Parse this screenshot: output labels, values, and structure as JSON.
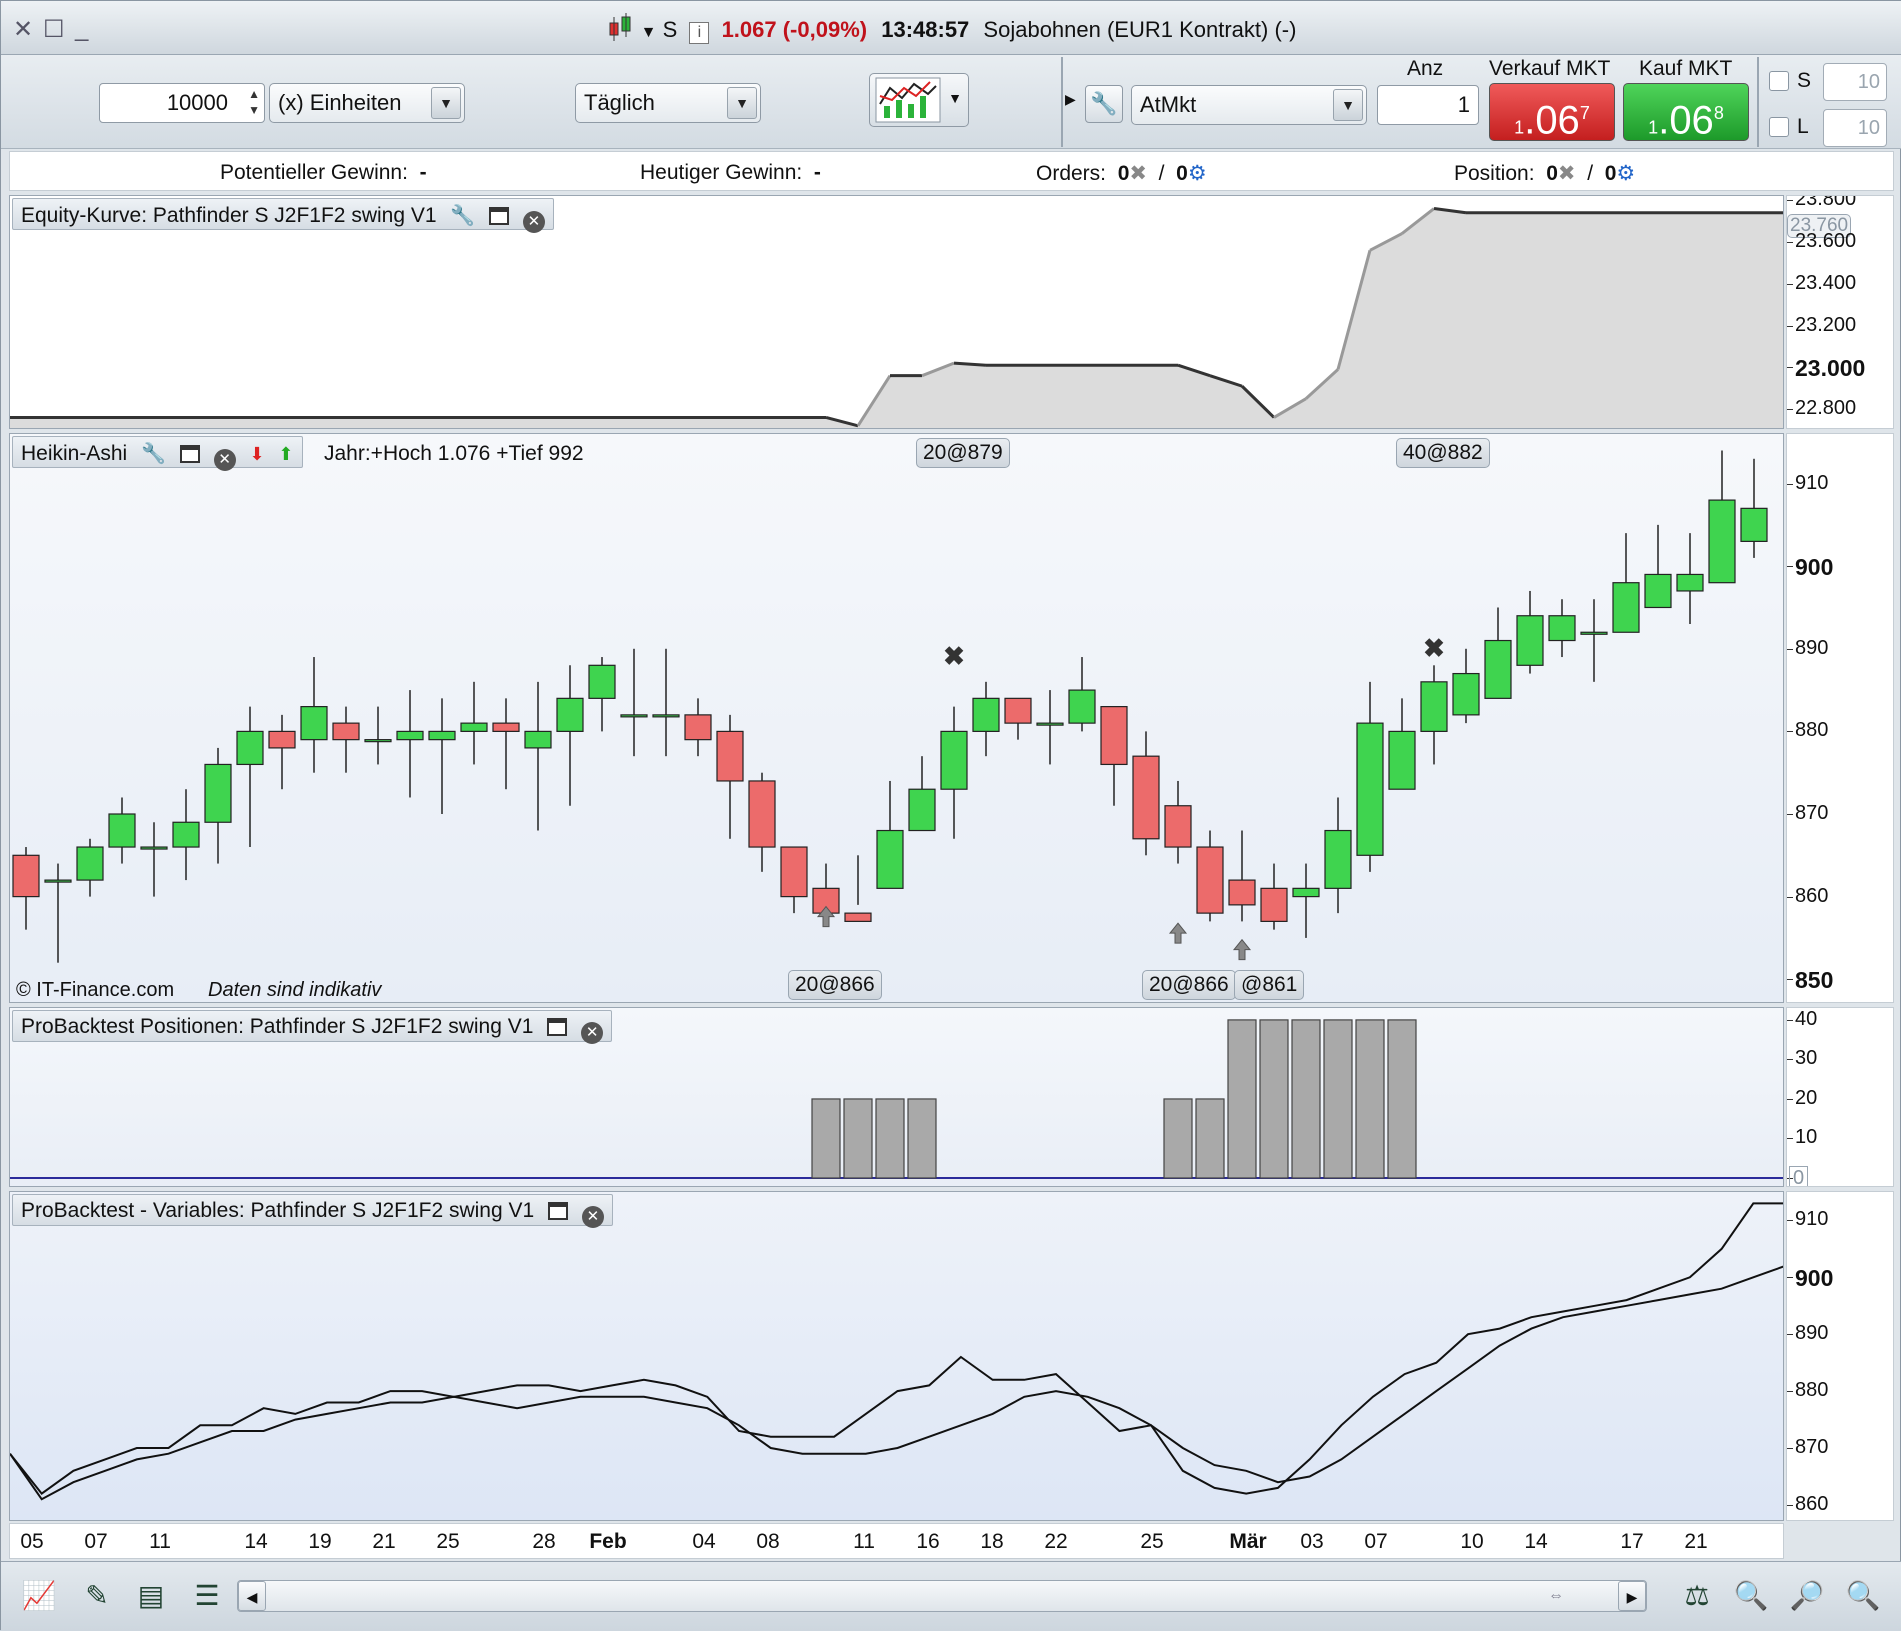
{
  "titlebar": {
    "mode": "S",
    "price_change": "1.067 (-0,09%)",
    "time": "13:48:57",
    "instrument": "Sojabohnen (EUR1 Kontrakt) (-)"
  },
  "toolbar": {
    "quantity": "10000",
    "units": "(x) Einheiten",
    "period": "Täglich",
    "order_type": "AtMkt",
    "anz_label": "Anz",
    "anz_value": "1",
    "sell_label": "Verkauf MKT",
    "buy_label": "Kauf MKT",
    "sell_small": "1",
    "sell_big": "06",
    "sell_sup": "7",
    "buy_small": "1",
    "buy_big": "06",
    "buy_sup": "8",
    "s_label": "S",
    "l_label": "L",
    "s_value": "10",
    "l_value": "10"
  },
  "infobar": {
    "potential_label": "Potentieller Gewinn:",
    "potential_value": "-",
    "today_label": "Heutiger Gewinn:",
    "today_value": "-",
    "orders_label": "Orders:",
    "orders_a": "0",
    "orders_sep": "/",
    "orders_b": "0",
    "position_label": "Position:",
    "position_a": "0",
    "position_sep": "/",
    "position_b": "0"
  },
  "equity_panel": {
    "title": "Equity-Kurve: Pathfinder S J2F1F2 swing V1",
    "current_tag": "23.760",
    "ticks": [
      "23.800",
      "23.600",
      "23.400",
      "23.200",
      "23.000",
      "22.800"
    ]
  },
  "price_panel": {
    "title": "Heikin-Ashi",
    "info": "Jahr:+Hoch 1.076 +Tief 992",
    "copyright": "© IT-Finance.com",
    "disclaimer": "Daten sind indikativ",
    "trade_tags": [
      "20@879",
      "40@882",
      "20@866",
      "20@866",
      "@861"
    ],
    "ticks": [
      "910",
      "900",
      "890",
      "880",
      "870",
      "860",
      "850"
    ]
  },
  "positions_panel": {
    "title": "ProBacktest Positionen: Pathfinder S J2F1F2 swing V1",
    "ticks": [
      "40",
      "30",
      "20",
      "10",
      "0"
    ]
  },
  "variables_panel": {
    "title": "ProBacktest - Variables: Pathfinder S J2F1F2 swing V1",
    "ticks": [
      "910",
      "900",
      "890",
      "880",
      "870",
      "860"
    ]
  },
  "xaxis": {
    "labels": [
      "05",
      "07",
      "11",
      "14",
      "19",
      "21",
      "25",
      "28",
      "Feb",
      "04",
      "08",
      "11",
      "16",
      "18",
      "22",
      "25",
      "Mär",
      "03",
      "07",
      "10",
      "14",
      "17",
      "21"
    ]
  },
  "chart_data": [
    {
      "type": "area",
      "title": "Equity-Kurve: Pathfinder S J2F1F2 swing V1",
      "ylim": [
        22700,
        23820
      ],
      "x": [
        0,
        25,
        26,
        27,
        28,
        29,
        30,
        31,
        32,
        33,
        34,
        35,
        36,
        37,
        38,
        39,
        40,
        41,
        42,
        43,
        44,
        45,
        46,
        47,
        48,
        55
      ],
      "values": [
        22760,
        22760,
        22720,
        22960,
        22960,
        23020,
        23010,
        23010,
        23010,
        23010,
        23010,
        23010,
        23010,
        22960,
        22910,
        22760,
        22850,
        22990,
        23560,
        23640,
        23760,
        23740,
        23740,
        23740,
        23740,
        23740
      ]
    },
    {
      "type": "candlestick",
      "title": "Heikin-Ashi",
      "ylim": [
        847,
        916
      ],
      "series": [
        {
          "name": "Heikin-Ashi",
          "values": [
            [
              865,
              860,
              866,
              856
            ],
            [
              862,
              862,
              864,
              852
            ],
            [
              862,
              866,
              867,
              860
            ],
            [
              866,
              870,
              872,
              864
            ],
            [
              866,
              866,
              869,
              860
            ],
            [
              866,
              869,
              873,
              862
            ],
            [
              869,
              876,
              878,
              864
            ],
            [
              876,
              880,
              883,
              866
            ],
            [
              880,
              878,
              882,
              873
            ],
            [
              879,
              883,
              889,
              875
            ],
            [
              881,
              879,
              883,
              875
            ],
            [
              879,
              879,
              883,
              876
            ],
            [
              879,
              880,
              885,
              872
            ],
            [
              879,
              880,
              884,
              870
            ],
            [
              880,
              881,
              886,
              876
            ],
            [
              881,
              880,
              884,
              873
            ],
            [
              878,
              880,
              886,
              868
            ],
            [
              880,
              884,
              888,
              871
            ],
            [
              884,
              888,
              889,
              880
            ],
            [
              882,
              882,
              890,
              877
            ],
            [
              882,
              882,
              890,
              877
            ],
            [
              882,
              879,
              884,
              877
            ],
            [
              880,
              874,
              882,
              867
            ],
            [
              874,
              866,
              875,
              863
            ],
            [
              866,
              860,
              866,
              858
            ],
            [
              861,
              858,
              864,
              857
            ],
            [
              858,
              857,
              865,
              859
            ],
            [
              861,
              868,
              874,
              864
            ],
            [
              868,
              873,
              877,
              869
            ],
            [
              873,
              880,
              883,
              867
            ],
            [
              880,
              884,
              886,
              877
            ],
            [
              884,
              881,
              882,
              879
            ],
            [
              881,
              881,
              885,
              876
            ],
            [
              881,
              885,
              889,
              880
            ],
            [
              883,
              876,
              883,
              871
            ],
            [
              877,
              867,
              880,
              865
            ],
            [
              871,
              866,
              874,
              864
            ],
            [
              866,
              858,
              868,
              857
            ],
            [
              862,
              859,
              868,
              857
            ],
            [
              861,
              857,
              864,
              856
            ],
            [
              860,
              861,
              864,
              855
            ],
            [
              861,
              868,
              872,
              858
            ],
            [
              865,
              881,
              886,
              863
            ],
            [
              873,
              880,
              884,
              876
            ],
            [
              880,
              886,
              888,
              876
            ],
            [
              882,
              887,
              890,
              881
            ],
            [
              884,
              891,
              895,
              884
            ],
            [
              888,
              894,
              897,
              887
            ],
            [
              891,
              894,
              896,
              889
            ],
            [
              892,
              892,
              896,
              886
            ],
            [
              892,
              898,
              904,
              892
            ],
            [
              895,
              899,
              905,
              895
            ],
            [
              897,
              899,
              904,
              893
            ],
            [
              898,
              908,
              914,
              898
            ],
            [
              903,
              907,
              913,
              901
            ]
          ]
        }
      ]
    },
    {
      "type": "bar",
      "title": "ProBacktest Positionen: Pathfinder S J2F1F2 swing V1",
      "ylim": [
        0,
        42
      ],
      "x": [
        25,
        26,
        27,
        28,
        36,
        37,
        38,
        39,
        40,
        41,
        42,
        43
      ],
      "values": [
        20,
        20,
        20,
        20,
        20,
        20,
        40,
        40,
        40,
        40,
        40,
        40
      ]
    },
    {
      "type": "line",
      "title": "ProBacktest - Variables: Pathfinder S J2F1F2 swing V1",
      "ylim": [
        857,
        915
      ],
      "series": [
        {
          "name": "",
          "values": [
            869,
            861,
            864,
            866,
            868,
            869,
            871,
            873,
            873,
            875,
            876,
            877,
            878,
            878,
            879,
            878,
            877,
            878,
            879,
            879,
            879,
            878,
            877,
            874,
            870,
            869,
            869,
            869,
            870,
            872,
            874,
            876,
            879,
            880,
            879,
            877,
            874,
            870,
            867,
            866,
            864,
            865,
            868,
            872,
            876,
            880,
            884,
            888,
            891,
            893,
            894,
            895,
            896,
            897,
            898,
            900,
            902
          ]
        },
        {
          "name": "",
          "values": [
            869,
            862,
            866,
            868,
            870,
            870,
            874,
            874,
            877,
            876,
            878,
            878,
            880,
            880,
            879,
            880,
            881,
            881,
            880,
            881,
            882,
            881,
            879,
            873,
            872,
            872,
            872,
            876,
            880,
            881,
            886,
            882,
            882,
            883,
            878,
            873,
            874,
            866,
            863,
            862,
            863,
            868,
            874,
            879,
            883,
            885,
            890,
            891,
            893,
            894,
            895,
            896,
            898,
            900,
            905,
            913,
            913
          ]
        }
      ]
    }
  ]
}
